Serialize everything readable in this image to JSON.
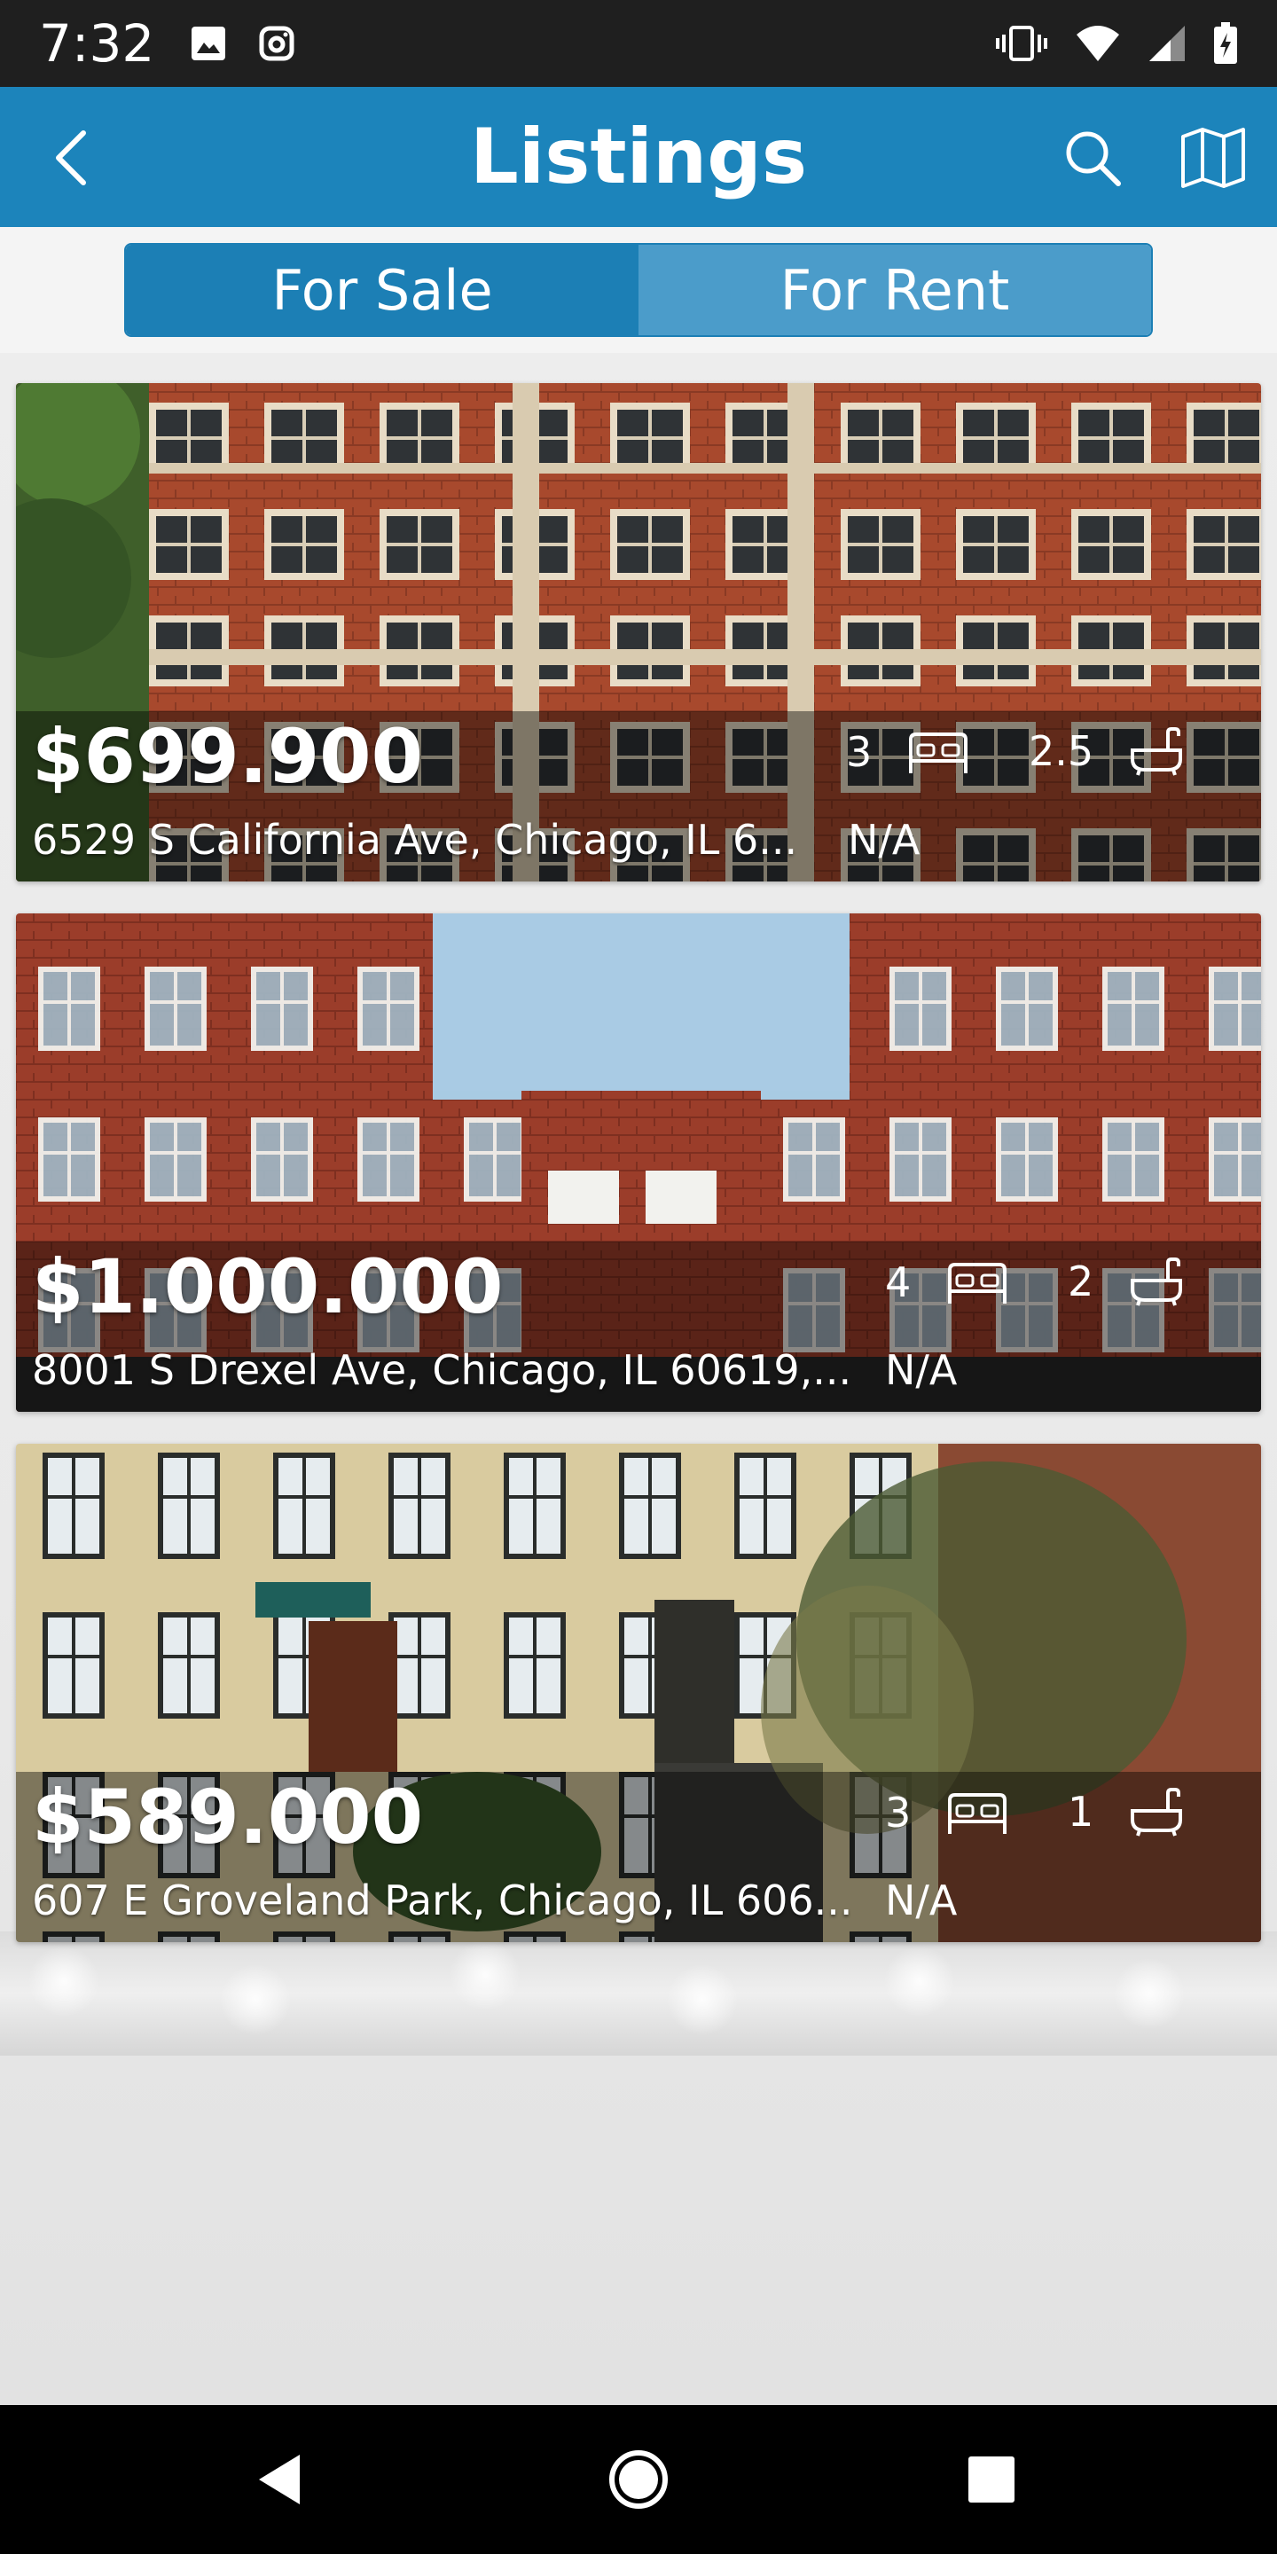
{
  "status_bar": {
    "time": "7:32",
    "icons": [
      "image-icon",
      "instagram-icon",
      "vibrate-icon",
      "wifi-icon",
      "signal-icon",
      "battery-icon"
    ]
  },
  "app_bar": {
    "title": "Listings",
    "back_icon": "chevron-left-icon",
    "search_icon": "search-icon",
    "map_icon": "map-icon",
    "color": "#1c84bb"
  },
  "segment": {
    "tabs": [
      {
        "label": "For Sale",
        "active": true
      },
      {
        "label": "For Rent",
        "active": false
      }
    ]
  },
  "listings": [
    {
      "price": "$699.900",
      "address": "6529 S California Ave,  Chicago, IL 6...",
      "area": "N/A",
      "beds": "3",
      "baths": "2.5"
    },
    {
      "price": "$1.000.000",
      "address": "8001 S Drexel Ave,  Chicago, IL 60619,...",
      "area": "N/A",
      "beds": "4",
      "baths": "2"
    },
    {
      "price": "$589.000",
      "address": "607 E Groveland Park,  Chicago, IL 606...",
      "area": "N/A",
      "beds": "3",
      "baths": "1"
    }
  ],
  "nav_bar": {
    "icons": [
      "back-triangle-icon",
      "home-circle-icon",
      "recents-square-icon"
    ]
  }
}
